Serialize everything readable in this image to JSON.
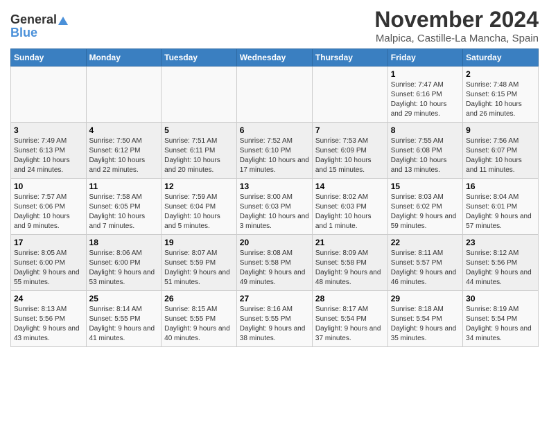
{
  "header": {
    "logo_general": "General",
    "logo_blue": "Blue",
    "month": "November 2024",
    "location": "Malpica, Castille-La Mancha, Spain"
  },
  "weekdays": [
    "Sunday",
    "Monday",
    "Tuesday",
    "Wednesday",
    "Thursday",
    "Friday",
    "Saturday"
  ],
  "weeks": [
    [
      {
        "day": "",
        "info": ""
      },
      {
        "day": "",
        "info": ""
      },
      {
        "day": "",
        "info": ""
      },
      {
        "day": "",
        "info": ""
      },
      {
        "day": "",
        "info": ""
      },
      {
        "day": "1",
        "info": "Sunrise: 7:47 AM\nSunset: 6:16 PM\nDaylight: 10 hours and 29 minutes."
      },
      {
        "day": "2",
        "info": "Sunrise: 7:48 AM\nSunset: 6:15 PM\nDaylight: 10 hours and 26 minutes."
      }
    ],
    [
      {
        "day": "3",
        "info": "Sunrise: 7:49 AM\nSunset: 6:13 PM\nDaylight: 10 hours and 24 minutes."
      },
      {
        "day": "4",
        "info": "Sunrise: 7:50 AM\nSunset: 6:12 PM\nDaylight: 10 hours and 22 minutes."
      },
      {
        "day": "5",
        "info": "Sunrise: 7:51 AM\nSunset: 6:11 PM\nDaylight: 10 hours and 20 minutes."
      },
      {
        "day": "6",
        "info": "Sunrise: 7:52 AM\nSunset: 6:10 PM\nDaylight: 10 hours and 17 minutes."
      },
      {
        "day": "7",
        "info": "Sunrise: 7:53 AM\nSunset: 6:09 PM\nDaylight: 10 hours and 15 minutes."
      },
      {
        "day": "8",
        "info": "Sunrise: 7:55 AM\nSunset: 6:08 PM\nDaylight: 10 hours and 13 minutes."
      },
      {
        "day": "9",
        "info": "Sunrise: 7:56 AM\nSunset: 6:07 PM\nDaylight: 10 hours and 11 minutes."
      }
    ],
    [
      {
        "day": "10",
        "info": "Sunrise: 7:57 AM\nSunset: 6:06 PM\nDaylight: 10 hours and 9 minutes."
      },
      {
        "day": "11",
        "info": "Sunrise: 7:58 AM\nSunset: 6:05 PM\nDaylight: 10 hours and 7 minutes."
      },
      {
        "day": "12",
        "info": "Sunrise: 7:59 AM\nSunset: 6:04 PM\nDaylight: 10 hours and 5 minutes."
      },
      {
        "day": "13",
        "info": "Sunrise: 8:00 AM\nSunset: 6:03 PM\nDaylight: 10 hours and 3 minutes."
      },
      {
        "day": "14",
        "info": "Sunrise: 8:02 AM\nSunset: 6:03 PM\nDaylight: 10 hours and 1 minute."
      },
      {
        "day": "15",
        "info": "Sunrise: 8:03 AM\nSunset: 6:02 PM\nDaylight: 9 hours and 59 minutes."
      },
      {
        "day": "16",
        "info": "Sunrise: 8:04 AM\nSunset: 6:01 PM\nDaylight: 9 hours and 57 minutes."
      }
    ],
    [
      {
        "day": "17",
        "info": "Sunrise: 8:05 AM\nSunset: 6:00 PM\nDaylight: 9 hours and 55 minutes."
      },
      {
        "day": "18",
        "info": "Sunrise: 8:06 AM\nSunset: 6:00 PM\nDaylight: 9 hours and 53 minutes."
      },
      {
        "day": "19",
        "info": "Sunrise: 8:07 AM\nSunset: 5:59 PM\nDaylight: 9 hours and 51 minutes."
      },
      {
        "day": "20",
        "info": "Sunrise: 8:08 AM\nSunset: 5:58 PM\nDaylight: 9 hours and 49 minutes."
      },
      {
        "day": "21",
        "info": "Sunrise: 8:09 AM\nSunset: 5:58 PM\nDaylight: 9 hours and 48 minutes."
      },
      {
        "day": "22",
        "info": "Sunrise: 8:11 AM\nSunset: 5:57 PM\nDaylight: 9 hours and 46 minutes."
      },
      {
        "day": "23",
        "info": "Sunrise: 8:12 AM\nSunset: 5:56 PM\nDaylight: 9 hours and 44 minutes."
      }
    ],
    [
      {
        "day": "24",
        "info": "Sunrise: 8:13 AM\nSunset: 5:56 PM\nDaylight: 9 hours and 43 minutes."
      },
      {
        "day": "25",
        "info": "Sunrise: 8:14 AM\nSunset: 5:55 PM\nDaylight: 9 hours and 41 minutes."
      },
      {
        "day": "26",
        "info": "Sunrise: 8:15 AM\nSunset: 5:55 PM\nDaylight: 9 hours and 40 minutes."
      },
      {
        "day": "27",
        "info": "Sunrise: 8:16 AM\nSunset: 5:55 PM\nDaylight: 9 hours and 38 minutes."
      },
      {
        "day": "28",
        "info": "Sunrise: 8:17 AM\nSunset: 5:54 PM\nDaylight: 9 hours and 37 minutes."
      },
      {
        "day": "29",
        "info": "Sunrise: 8:18 AM\nSunset: 5:54 PM\nDaylight: 9 hours and 35 minutes."
      },
      {
        "day": "30",
        "info": "Sunrise: 8:19 AM\nSunset: 5:54 PM\nDaylight: 9 hours and 34 minutes."
      }
    ]
  ]
}
